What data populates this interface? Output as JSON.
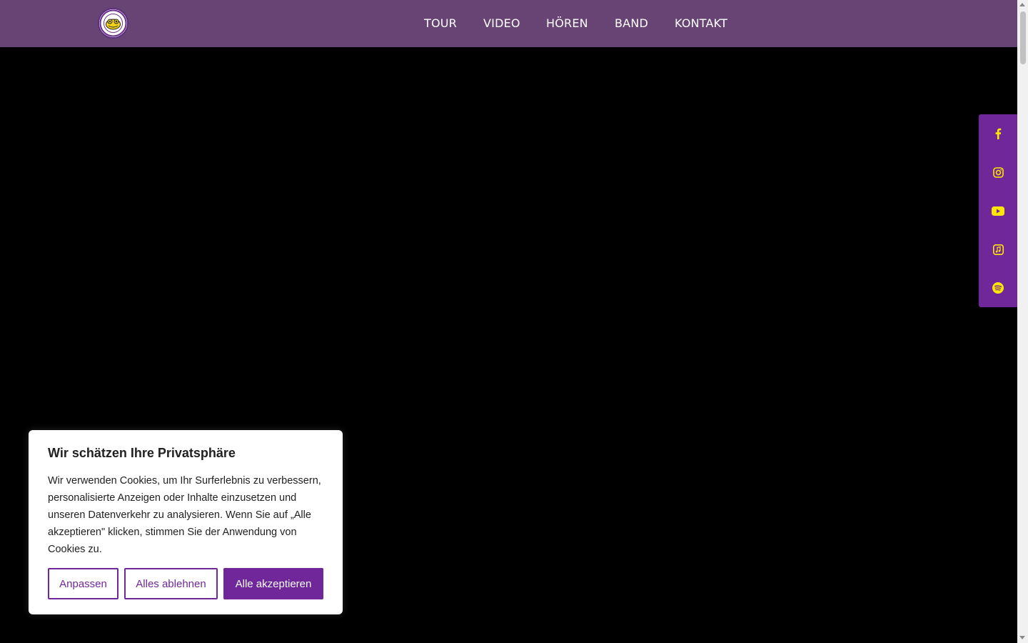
{
  "header": {
    "nav": [
      {
        "label": "TOUR"
      },
      {
        "label": "VIDEO"
      },
      {
        "label": "HÖREN"
      },
      {
        "label": "BAND"
      },
      {
        "label": "KONTAKT"
      }
    ]
  },
  "social": [
    {
      "icon": "facebook-icon"
    },
    {
      "icon": "instagram-icon"
    },
    {
      "icon": "youtube-icon"
    },
    {
      "icon": "apple-music-icon"
    },
    {
      "icon": "spotify-icon"
    }
  ],
  "cookie": {
    "title": "Wir schätzen Ihre Privatsphäre",
    "text": "Wir verwenden Cookies, um Ihr Surferlebnis zu verbessern, personalisierte Anzeigen oder Inhalte einzusetzen und unseren Datenverkehr zu analysieren. Wenn Sie auf „Alle akzeptieren\" klicken, stimmen Sie der Anwendung von Cookies zu.",
    "customize_label": "Anpassen",
    "reject_label": "Alles ablehnen",
    "accept_label": "Alle akzeptieren"
  },
  "colors": {
    "header_bg": "#684474",
    "accent": "#70279a",
    "icon": "#ffe600"
  }
}
